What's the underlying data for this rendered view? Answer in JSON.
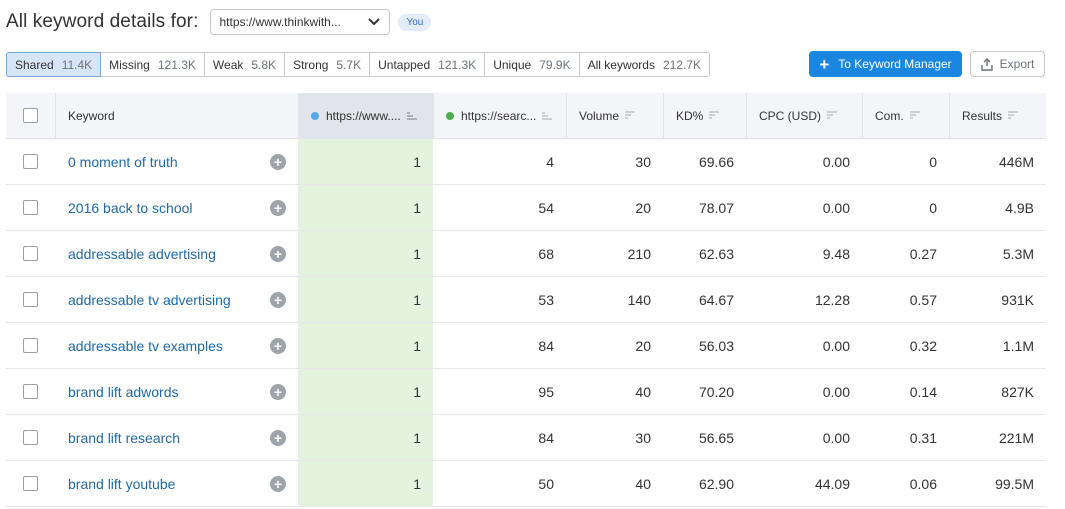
{
  "header": {
    "title": "All keyword details for:",
    "domain_select": "https://www.thinkwith...",
    "you_badge": "You"
  },
  "filters": [
    {
      "label": "Shared",
      "count": "11.4K",
      "active": true
    },
    {
      "label": "Missing",
      "count": "121.3K",
      "active": false
    },
    {
      "label": "Weak",
      "count": "5.8K",
      "active": false
    },
    {
      "label": "Strong",
      "count": "5.7K",
      "active": false
    },
    {
      "label": "Untapped",
      "count": "121.3K",
      "active": false
    },
    {
      "label": "Unique",
      "count": "79.9K",
      "active": false
    },
    {
      "label": "All keywords",
      "count": "212.7K",
      "active": false
    }
  ],
  "actions": {
    "keyword_manager": "To Keyword Manager",
    "export": "Export"
  },
  "colors": {
    "domain1_dot": "#5aa7e8",
    "domain2_dot": "#4cae4f",
    "primary": "#1a86e0"
  },
  "table": {
    "columns": {
      "keyword": "Keyword",
      "domain1": "https://www....",
      "domain2": "https://searc...",
      "volume": "Volume",
      "kd": "KD%",
      "cpc": "CPC (USD)",
      "com": "Com.",
      "results": "Results"
    },
    "rows": [
      {
        "keyword": "0 moment of truth",
        "d1": "1",
        "d2": "4",
        "volume": "30",
        "kd": "69.66",
        "cpc": "0.00",
        "com": "0",
        "results": "446M"
      },
      {
        "keyword": "2016 back to school",
        "d1": "1",
        "d2": "54",
        "volume": "20",
        "kd": "78.07",
        "cpc": "0.00",
        "com": "0",
        "results": "4.9B"
      },
      {
        "keyword": "addressable advertising",
        "d1": "1",
        "d2": "68",
        "volume": "210",
        "kd": "62.63",
        "cpc": "9.48",
        "com": "0.27",
        "results": "5.3M"
      },
      {
        "keyword": "addressable tv advertising",
        "d1": "1",
        "d2": "53",
        "volume": "140",
        "kd": "64.67",
        "cpc": "12.28",
        "com": "0.57",
        "results": "931K"
      },
      {
        "keyword": "addressable tv examples",
        "d1": "1",
        "d2": "84",
        "volume": "20",
        "kd": "56.03",
        "cpc": "0.00",
        "com": "0.32",
        "results": "1.1M"
      },
      {
        "keyword": "brand lift adwords",
        "d1": "1",
        "d2": "95",
        "volume": "40",
        "kd": "70.20",
        "cpc": "0.00",
        "com": "0.14",
        "results": "827K"
      },
      {
        "keyword": "brand lift research",
        "d1": "1",
        "d2": "84",
        "volume": "30",
        "kd": "56.65",
        "cpc": "0.00",
        "com": "0.31",
        "results": "221M"
      },
      {
        "keyword": "brand lift youtube",
        "d1": "1",
        "d2": "50",
        "volume": "40",
        "kd": "62.90",
        "cpc": "44.09",
        "com": "0.06",
        "results": "99.5M"
      }
    ]
  }
}
